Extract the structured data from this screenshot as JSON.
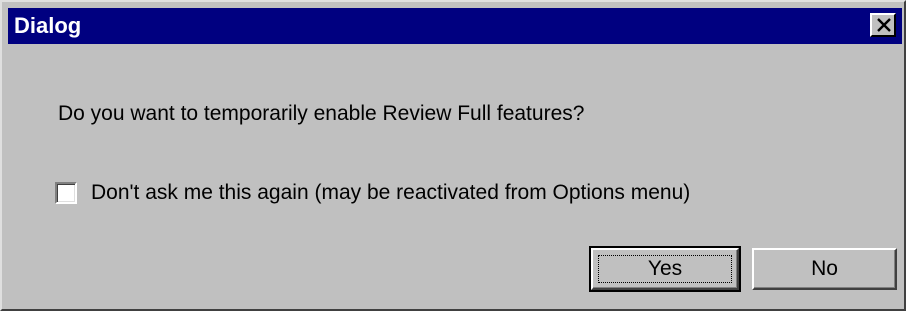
{
  "dialog": {
    "title": "Dialog",
    "close_icon": "close-icon",
    "message": "Do you want to temporarily enable Review Full features?",
    "checkbox": {
      "label": "Don't ask me this again (may be reactivated from Options menu)",
      "checked": false
    },
    "buttons": {
      "yes_label": "Yes",
      "no_label": "No"
    }
  },
  "colors": {
    "titlebar": "#000080",
    "face": "#c0c0c0",
    "title_text": "#ffffff"
  }
}
